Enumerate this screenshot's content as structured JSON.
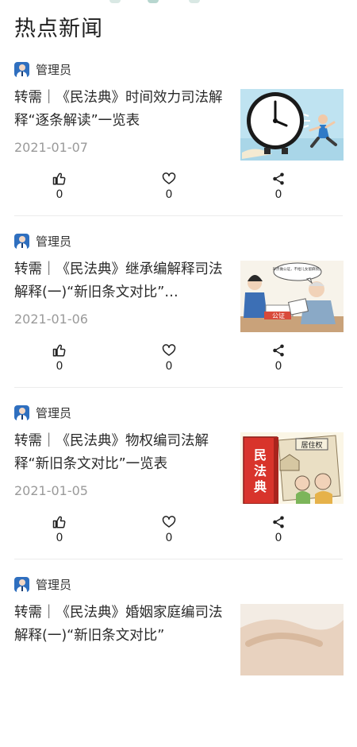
{
  "page": {
    "title": "热点新闻"
  },
  "articles": [
    {
      "author": "管理员",
      "title": "转需｜《民法典》时间效力司法解释“逐条解读”一览表",
      "date": "2021-01-07",
      "likes": "0",
      "favorites": "0",
      "shares": "0",
      "thumbnail": "clock-running-man-image"
    },
    {
      "author": "管理员",
      "title": "转需｜《民法典》继承编解释司法解释(一)“新旧条文对比”…",
      "date": "2021-01-06",
      "likes": "0",
      "favorites": "0",
      "shares": "0",
      "thumbnail": "notary-office-image",
      "thumb_text": {
        "speech": "早点做公证，不给儿女留麻烦。",
        "sign": "公证"
      }
    },
    {
      "author": "管理员",
      "title": "转需｜《民法典》物权编司法解释“新旧条文对比”一览表",
      "date": "2021-01-05",
      "likes": "0",
      "favorites": "0",
      "shares": "0",
      "thumbnail": "civil-code-book-image",
      "thumb_text": {
        "book": "民法典",
        "sign": "居住权"
      }
    },
    {
      "author": "管理员",
      "title": "转需｜《民法典》婚姻家庭编司法解释(一)“新旧条文对比”",
      "date": "",
      "likes": "",
      "favorites": "",
      "shares": "",
      "thumbnail": "hands-image"
    }
  ],
  "icons": {
    "like": "thumbs-up-icon",
    "favorite": "heart-icon",
    "share": "share-icon"
  },
  "colors": {
    "avatar": "#2f6fbf",
    "date": "#9a9a9a",
    "divider": "#ececec"
  }
}
